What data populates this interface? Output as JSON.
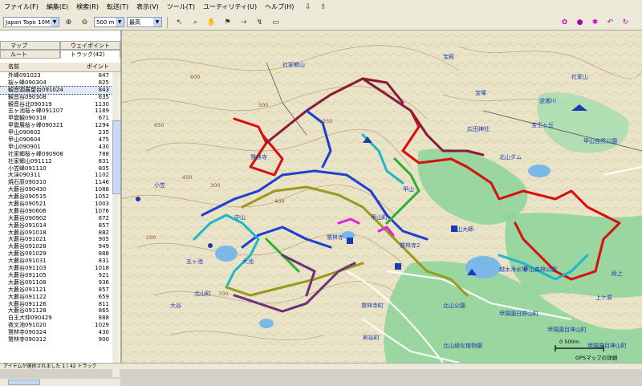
{
  "menu": [
    "ファイル(F)",
    "編集(E)",
    "検索(R)",
    "転送(T)",
    "表示(V)",
    "ツール(T)",
    "ユーティリティ(U)",
    "ヘルプ(H)"
  ],
  "toolbar": {
    "map_product": "Japan Topo 10M v7",
    "zoom_scale": "500 m",
    "detail_level": "最高"
  },
  "panel": {
    "tabs_top": [
      "マップ",
      "ウェイポイント"
    ],
    "tabs_bottom": [
      "ルート",
      "トラック(42)"
    ],
    "columns": {
      "name": "名前",
      "points": "ポイント"
    },
    "tracks": [
      {
        "name": "外峰091023",
        "points": "847"
      },
      {
        "name": "桜ヶ峰090304",
        "points": "825"
      },
      {
        "name": "観音頭展望台091024",
        "points": "843"
      },
      {
        "name": "観音谷090308",
        "points": "635"
      },
      {
        "name": "観音谷北090319",
        "points": "1130"
      },
      {
        "name": "五ヶ池桜ヶ峰091107",
        "points": "1189"
      },
      {
        "name": "甲震観090318",
        "points": "671"
      },
      {
        "name": "甲震展桜ヶ峰090321",
        "points": "1294"
      },
      {
        "name": "甲山090602",
        "points": "235"
      },
      {
        "name": "甲山090604",
        "points": "475"
      },
      {
        "name": "甲山090901",
        "points": "430"
      },
      {
        "name": "社家郷桜ヶ峰090908",
        "points": "788"
      },
      {
        "name": "社家郷山091112",
        "points": "831"
      },
      {
        "name": "小笠峰091110",
        "points": "805"
      },
      {
        "name": "大渓090311",
        "points": "1102"
      },
      {
        "name": "焼石原090310",
        "points": "1146"
      },
      {
        "name": "大藪谷090430",
        "points": "1088"
      },
      {
        "name": "大藪谷090515",
        "points": "1052"
      },
      {
        "name": "大藪谷090521",
        "points": "1003"
      },
      {
        "name": "大藪谷090606",
        "points": "1076"
      },
      {
        "name": "大藪谷090902",
        "points": "872"
      },
      {
        "name": "大藪谷091014",
        "points": "857"
      },
      {
        "name": "大藪谷091018",
        "points": "882"
      },
      {
        "name": "大藪谷091021",
        "points": "905"
      },
      {
        "name": "大藪谷091028",
        "points": "949"
      },
      {
        "name": "大藪谷091029",
        "points": "888"
      },
      {
        "name": "大藪谷091031",
        "points": "831"
      },
      {
        "name": "大藪谷091103",
        "points": "1018"
      },
      {
        "name": "大藪谷091105",
        "points": "921"
      },
      {
        "name": "大藪谷091108",
        "points": "936"
      },
      {
        "name": "大藪谷091121",
        "points": "857"
      },
      {
        "name": "大藪谷091122",
        "points": "659"
      },
      {
        "name": "大藪谷091126",
        "points": "811"
      },
      {
        "name": "大藪谷091128",
        "points": "865"
      },
      {
        "name": "白王大仲090429",
        "points": "888"
      },
      {
        "name": "夜叉池091020",
        "points": "1029"
      },
      {
        "name": "鷲林寺090324",
        "points": "430"
      },
      {
        "name": "鷲林寺090312",
        "points": "900"
      }
    ]
  },
  "map": {
    "labels": [
      "鷲林寺町",
      "鷲林寺2",
      "甲山町",
      "甲陽園日野山町",
      "北山公園",
      "甲山自然公園",
      "甲陽園目神山町",
      "甲山大師",
      "越水浄水場",
      "広田神社",
      "甲山",
      "鷲林寺",
      "社家郷山",
      "宝殿",
      "剣谷町",
      "社家山",
      "逆瀬川",
      "宝塚",
      "甲山森林公園",
      "北山緑化植物園",
      "上ケ原",
      "鷲林寺",
      "甲陽園目神山町",
      "段上",
      "中山",
      "小笠",
      "五ヶ池",
      "北山町",
      "北山ダム",
      "宝生ヶ丘",
      "大池",
      "大谷"
    ],
    "contours": [
      "200",
      "300",
      "400",
      "450",
      "500",
      "550",
      "600",
      "650",
      "700"
    ],
    "scale_text": "0  500m",
    "credit": "GPSマップの詳細"
  },
  "status": "アイテムが選択されました 1 / 42 トラック",
  "colors": {
    "red": "#d81010",
    "maroon": "#8a1c3a",
    "blue": "#2040d0",
    "cyan": "#20b8c8",
    "green": "#30b030",
    "olive": "#9a9a20",
    "purple": "#70307a",
    "magenta": "#e020e0",
    "forest": "#8cd498",
    "water": "#7ab8e8",
    "terrain": "#e9e4c8"
  }
}
